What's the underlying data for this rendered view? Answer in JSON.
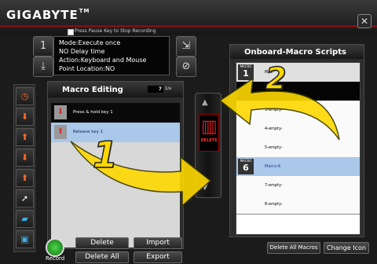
{
  "header": {
    "logo": "GIGABYTE",
    "trademark": "TM",
    "close_label": "✕",
    "record_hint": "Press Pause Key to Stop Recording"
  },
  "info": {
    "mode": "Mode:Execute once",
    "delay": "NO Delay time",
    "action": "Action:Keyboard and Mouse",
    "point": "Point Location:NO"
  },
  "macro_editing": {
    "title": "Macro Editing",
    "field_value": "7",
    "units": "1/s",
    "rows": [
      {
        "text": "Press & hold key 1"
      },
      {
        "text": "Release key 1"
      }
    ]
  },
  "delete_panel": {
    "label": "DELETE"
  },
  "onboard": {
    "title": "Onboard-Macro Scripts",
    "rows": [
      {
        "badge": "MACRO",
        "num": "1",
        "text": "Mac"
      },
      {
        "badge": "",
        "num": "",
        "text": ""
      },
      {
        "badge": "",
        "num": "",
        "text": "3-empty-"
      },
      {
        "badge": "",
        "num": "",
        "text": "4-empty-"
      },
      {
        "badge": "",
        "num": "",
        "text": "5-empty-"
      },
      {
        "badge": "MACRO",
        "num": "6",
        "text": "Macro-6"
      },
      {
        "badge": "",
        "num": "",
        "text": "7-empty-"
      },
      {
        "badge": "",
        "num": "",
        "text": "8-empty-"
      }
    ]
  },
  "buttons": {
    "delete": "Delete",
    "import": "Import",
    "delete_all": "Delete All",
    "export": "Export",
    "delete_all_macros": "Delete All Macros",
    "change_icon": "Change Icon",
    "record": "Record"
  },
  "annotations": {
    "step1": "1",
    "step2": "2"
  },
  "colors": {
    "accent_red": "#e01c1c",
    "arrow_yellow": "#ffd800",
    "selected_row": "#a9c8ea"
  }
}
